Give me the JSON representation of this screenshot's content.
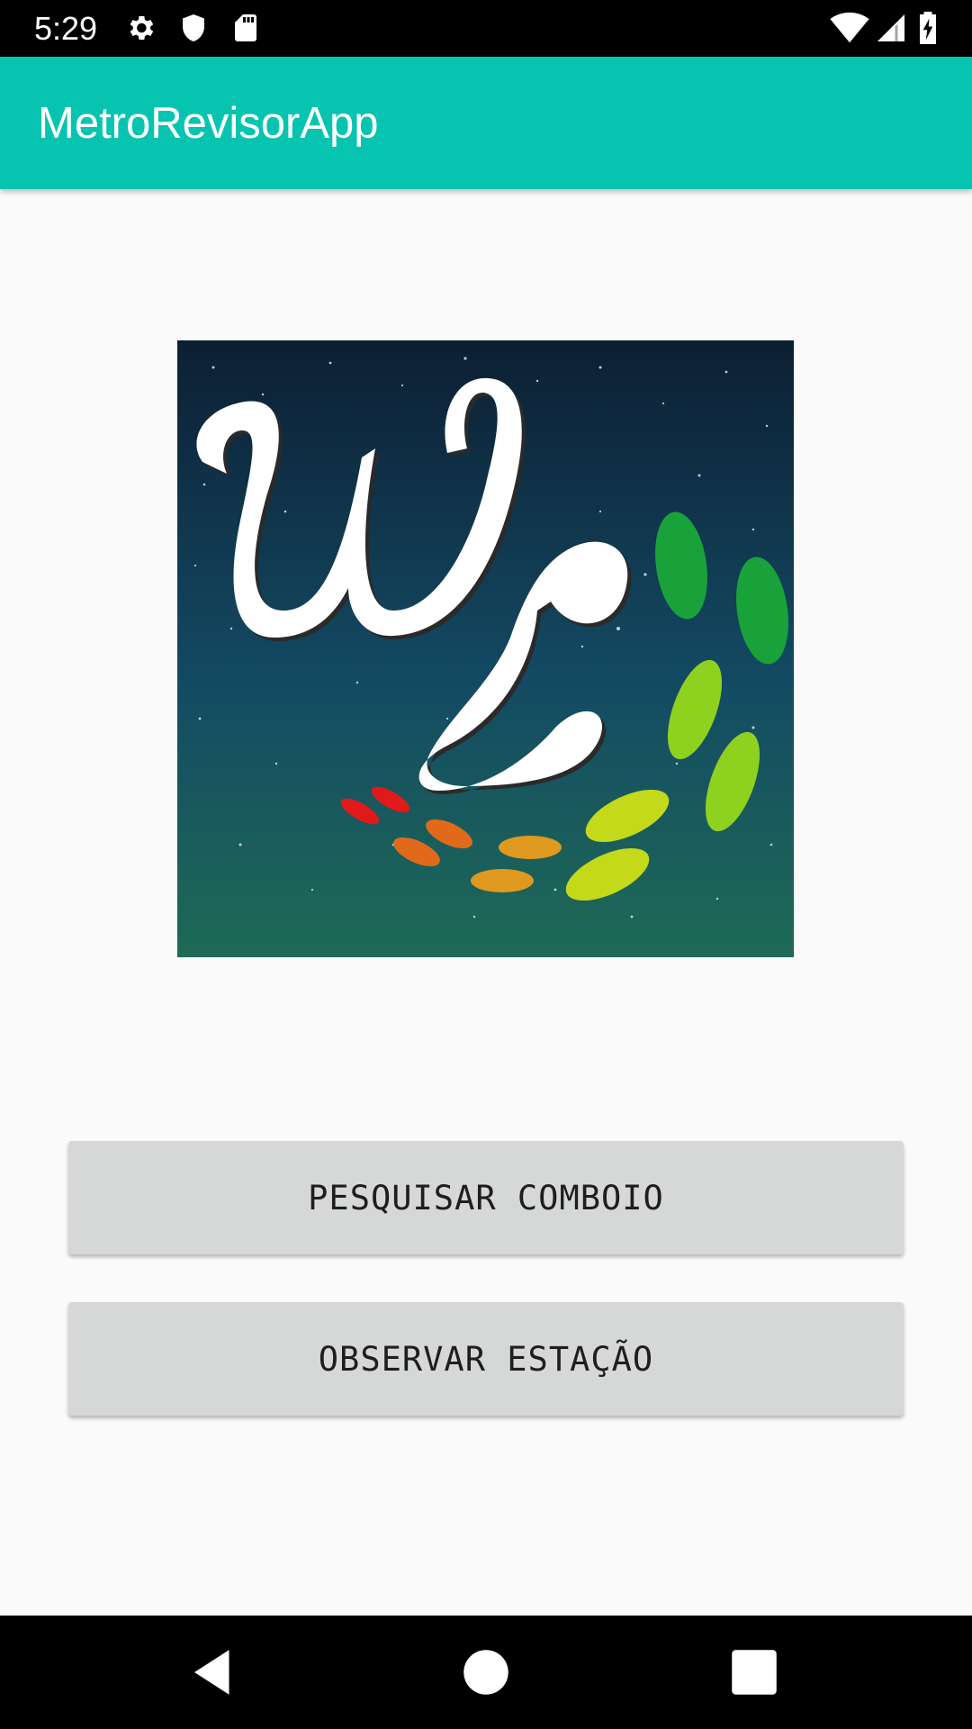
{
  "status_bar": {
    "time": "5:29",
    "left_icons": [
      "gear-icon",
      "shield-icon",
      "sd-card-icon"
    ],
    "right_icons": [
      "wifi-icon",
      "cell-signal-icon",
      "battery-charging-icon"
    ]
  },
  "app_bar": {
    "title": "MetroRevisorApp",
    "color": "#07c4b0"
  },
  "logo": {
    "letters": "WL",
    "background_top": "#0c1f33",
    "background_bottom": "#1e6a56"
  },
  "buttons": {
    "search_train": "PESQUISAR COMBOIO",
    "observe_station": "OBSERVAR ESTAÇÃO"
  },
  "nav_bar": {
    "items": [
      "back-icon",
      "home-icon",
      "recents-icon"
    ]
  }
}
